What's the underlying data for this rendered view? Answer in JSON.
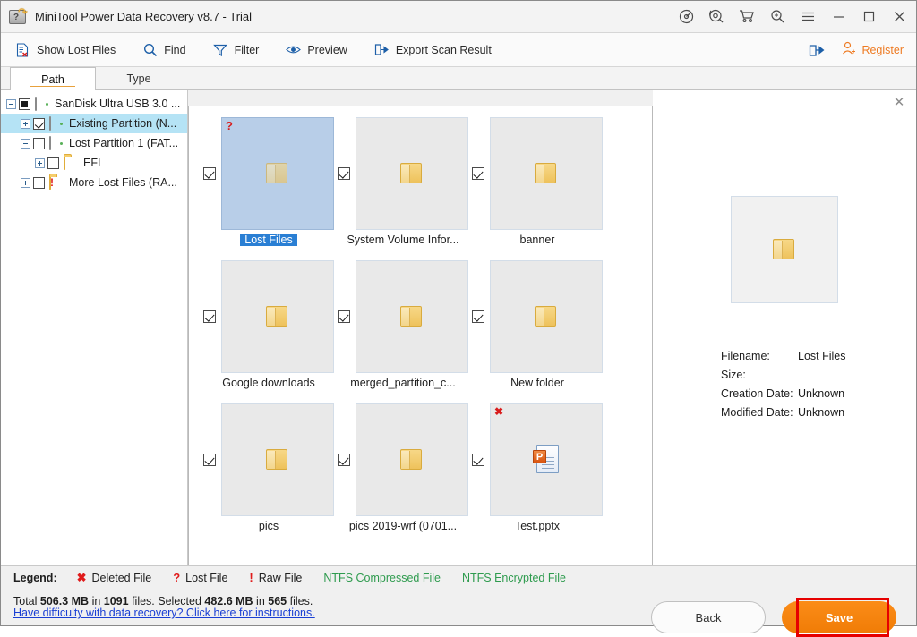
{
  "window": {
    "title": "MiniTool Power Data Recovery v8.7 - Trial",
    "app_icon": "hard-drive-recovery-icon",
    "controls": [
      {
        "name": "scan-disc-icon",
        "label": "Scan"
      },
      {
        "name": "support-headset-icon",
        "label": "Support"
      },
      {
        "name": "cart-icon",
        "label": "Buy"
      },
      {
        "name": "search-magnifier-icon",
        "label": "Search"
      },
      {
        "name": "menu-hamburger-icon",
        "label": "Menu"
      },
      {
        "name": "minimize-icon",
        "label": "Minimize"
      },
      {
        "name": "maximize-icon",
        "label": "Maximize"
      },
      {
        "name": "close-icon",
        "label": "Close"
      }
    ]
  },
  "toolbar": {
    "items": [
      {
        "icon": "document-lost-icon",
        "label": "Show Lost Files"
      },
      {
        "icon": "search-icon",
        "label": "Find"
      },
      {
        "icon": "funnel-icon",
        "label": "Filter"
      },
      {
        "icon": "eye-icon",
        "label": "Preview"
      },
      {
        "icon": "export-arrow-icon",
        "label": "Export Scan Result"
      }
    ],
    "share_icon": "share-arrow-icon",
    "register_icon": "user-add-icon",
    "register_label": "Register",
    "register_color": "#ee7b23"
  },
  "tabs": [
    {
      "label": "Path",
      "active": true
    },
    {
      "label": "Type",
      "active": false
    }
  ],
  "tree": {
    "nodes": [
      {
        "label": "SanDisk Ultra USB 3.0 ...",
        "indent": 0,
        "expander": "minus",
        "checkbox": "filled",
        "icon": "drive-icon",
        "selected": false
      },
      {
        "label": "Existing Partition (N...",
        "indent": 1,
        "expander": "plus",
        "checkbox": "checked",
        "icon": "drive-icon",
        "selected": true
      },
      {
        "label": "Lost Partition 1 (FAT...",
        "indent": 1,
        "expander": "minus",
        "checkbox": "empty",
        "icon": "drive-icon",
        "selected": false
      },
      {
        "label": "EFI",
        "indent": 2,
        "expander": "plus",
        "checkbox": "empty",
        "icon": "folder-icon",
        "selected": false
      },
      {
        "label": "More Lost Files (RA...",
        "indent": 1,
        "expander": "plus",
        "checkbox": "empty",
        "icon": "folder-warning-icon",
        "selected": false
      }
    ]
  },
  "grid": {
    "tiles": [
      {
        "name": "Lost Files",
        "icon": "folder-icon",
        "badge": "?",
        "badge_kind": "lost",
        "checked": true,
        "selected": true
      },
      {
        "name": "System Volume Infor...",
        "icon": "folder-icon",
        "badge": "",
        "badge_kind": "",
        "checked": true,
        "selected": false
      },
      {
        "name": "banner",
        "icon": "folder-icon",
        "badge": "",
        "badge_kind": "",
        "checked": true,
        "selected": false
      },
      {
        "name": "Google downloads",
        "icon": "folder-icon",
        "badge": "",
        "badge_kind": "",
        "checked": true,
        "selected": false
      },
      {
        "name": "merged_partition_c...",
        "icon": "folder-icon",
        "badge": "",
        "badge_kind": "",
        "checked": true,
        "selected": false
      },
      {
        "name": "New folder",
        "icon": "folder-icon",
        "badge": "",
        "badge_kind": "",
        "checked": true,
        "selected": false
      },
      {
        "name": "pics",
        "icon": "folder-icon",
        "badge": "",
        "badge_kind": "",
        "checked": true,
        "selected": false
      },
      {
        "name": "pics 2019-wrf (0701...",
        "icon": "folder-icon",
        "badge": "",
        "badge_kind": "",
        "checked": true,
        "selected": false
      },
      {
        "name": "Test.pptx",
        "icon": "powerpoint-icon",
        "badge": "✖",
        "badge_kind": "deleted",
        "checked": true,
        "selected": false
      }
    ]
  },
  "preview": {
    "close_icon": "close-icon",
    "thumb_icon": "folder-icon",
    "fields": [
      {
        "key": "Filename:",
        "value": "Lost Files"
      },
      {
        "key": "Size:",
        "value": ""
      },
      {
        "key": "Creation Date:",
        "value": "Unknown"
      },
      {
        "key": "Modified Date:",
        "value": "Unknown"
      }
    ]
  },
  "legend": {
    "label": "Legend:",
    "items": [
      {
        "symbol": "✖",
        "label": "Deleted File",
        "color": "#e01b1b"
      },
      {
        "symbol": "?",
        "label": "Lost File",
        "color": "#e01b1b"
      },
      {
        "symbol": "!",
        "label": "Raw File",
        "color": "#e01b1b"
      }
    ],
    "green_items": [
      {
        "label": "NTFS Compressed File",
        "color": "#2e9b4e"
      },
      {
        "label": "NTFS Encrypted File",
        "color": "#2e9b4e"
      }
    ]
  },
  "status": {
    "total_prefix": "Total ",
    "total_size": "506.3 MB",
    "total_mid": " in ",
    "total_files": "1091",
    "total_suffix": " files.  ",
    "sel_prefix": "Selected ",
    "sel_size": "482.6 MB",
    "sel_mid": " in ",
    "sel_files": "565",
    "sel_suffix": " files.",
    "help_link": "Have difficulty with data recovery? Click here for instructions."
  },
  "buttons": {
    "back": "Back",
    "save": "Save",
    "save_color": "#f58220",
    "highlight_color": "#e60000"
  }
}
